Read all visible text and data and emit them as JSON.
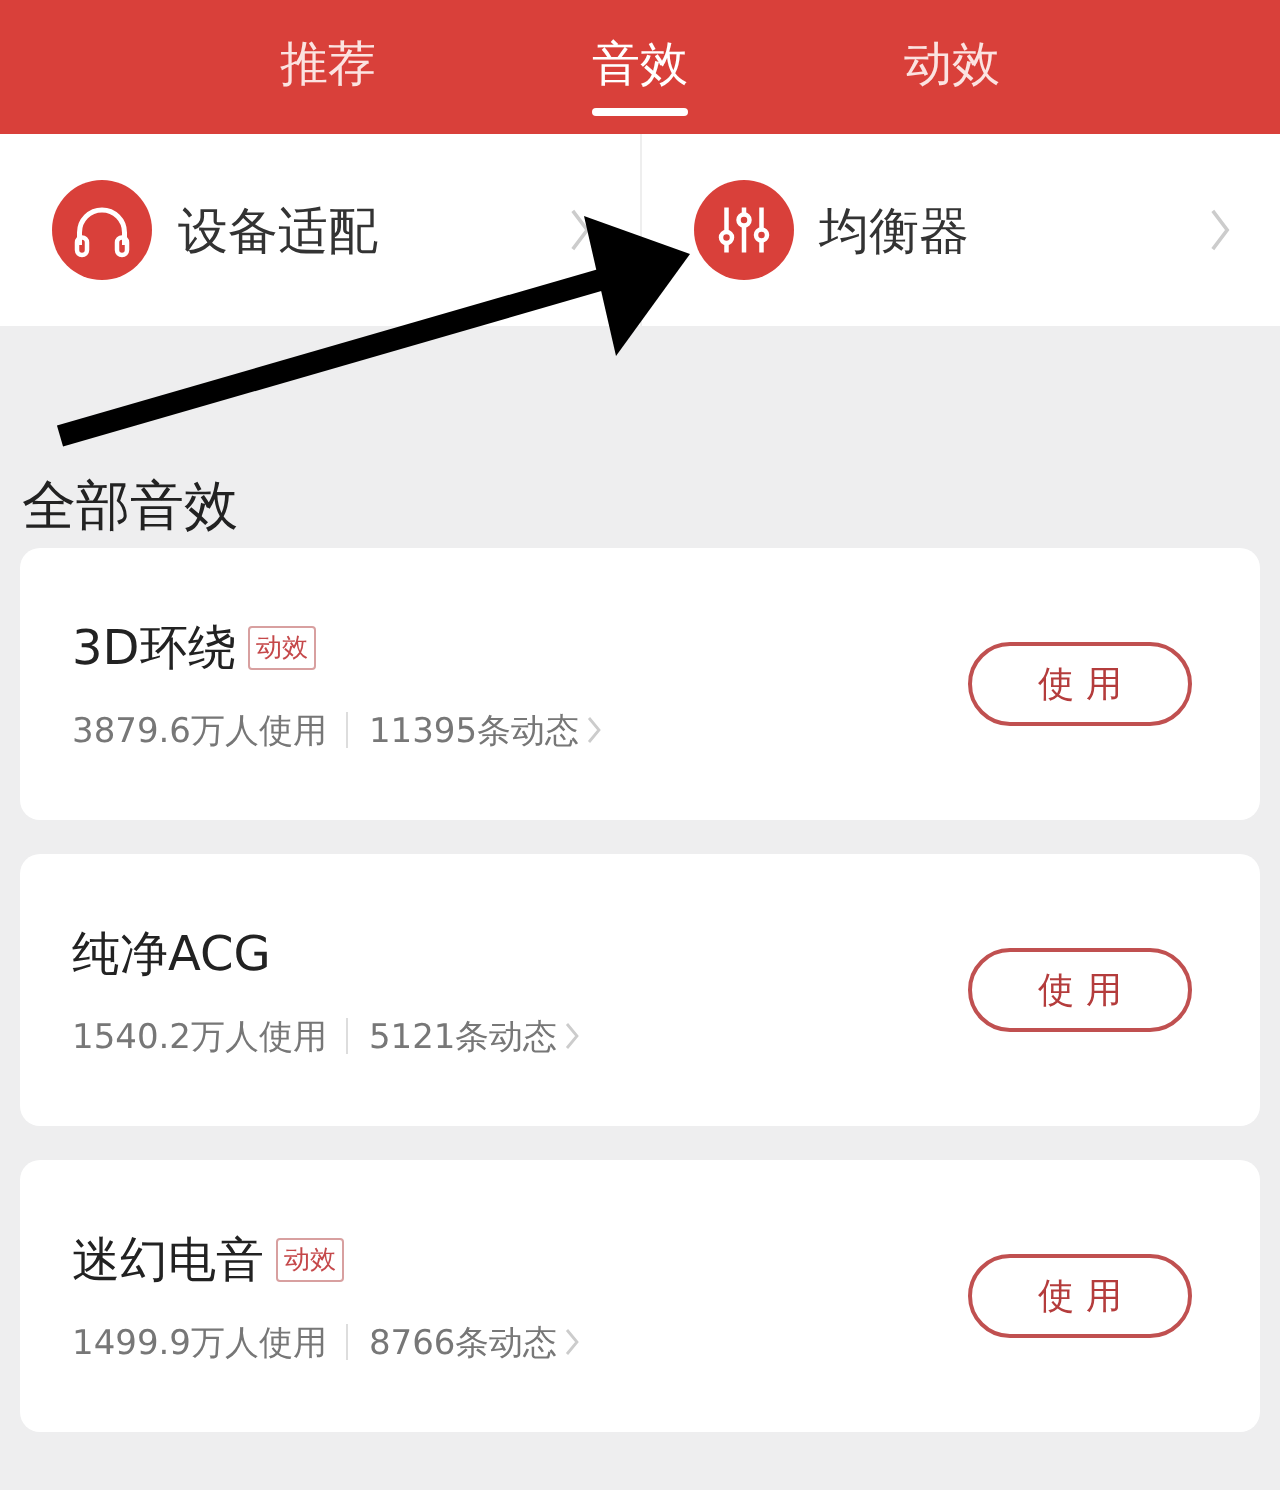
{
  "tabs": [
    {
      "label": "推荐",
      "selected": false
    },
    {
      "label": "音效",
      "selected": true
    },
    {
      "label": "动效",
      "selected": false
    }
  ],
  "shortcuts": [
    {
      "kind": "headphones",
      "label": "设备适配"
    },
    {
      "kind": "equalizer",
      "label": "均衡器"
    }
  ],
  "section_title": "全部音效",
  "effects": [
    {
      "name": "3D环绕",
      "tag": "动效",
      "users": "3879.6万人使用",
      "posts": "11395条动态",
      "button": "使 用"
    },
    {
      "name": "纯净ACG",
      "users": "1540.2万人使用",
      "posts": "5121条动态",
      "button": "使 用"
    },
    {
      "name": "迷幻电音",
      "tag": "动效",
      "users": "1499.9万人使用",
      "posts": "8766条动态",
      "button": "使 用"
    }
  ]
}
